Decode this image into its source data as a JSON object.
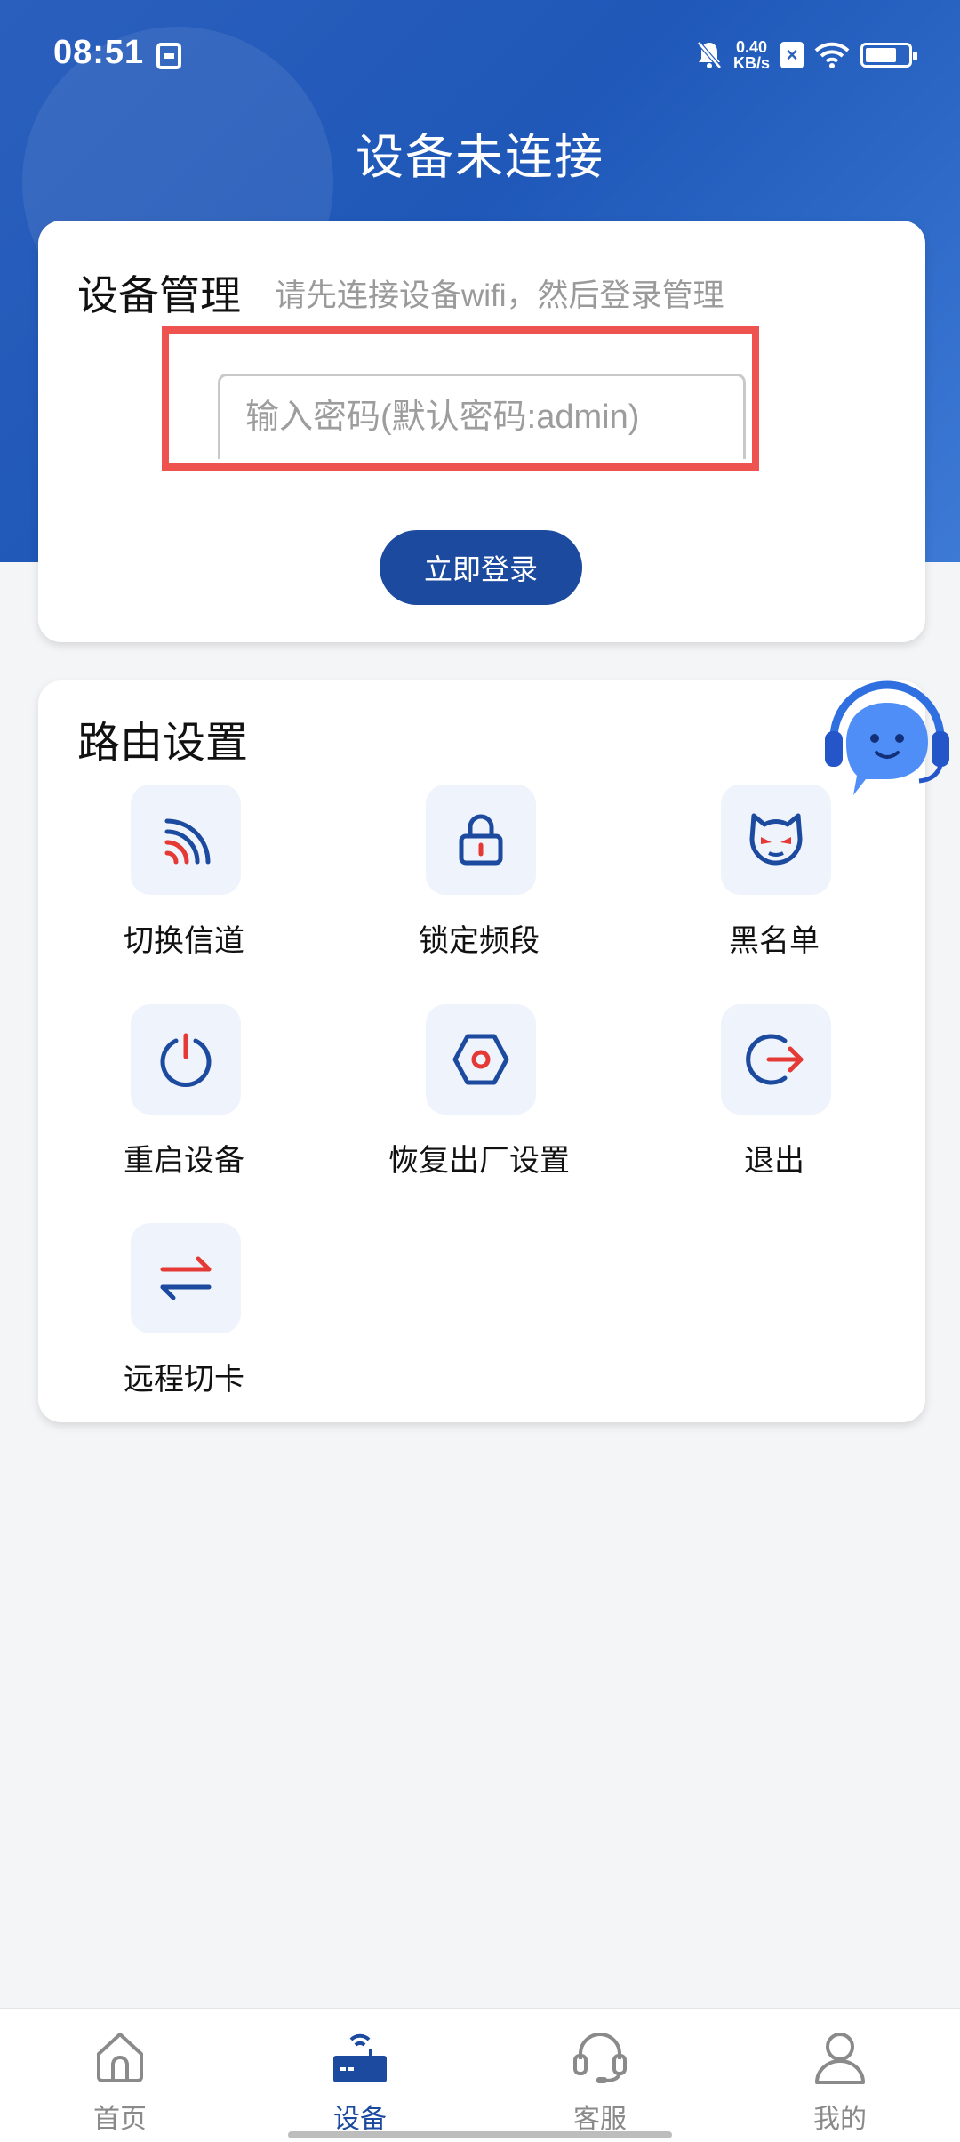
{
  "status_bar": {
    "time": "08:51",
    "net_speed_value": "0.40",
    "net_speed_unit": "KB/s",
    "battery_level": 0.7
  },
  "header": {
    "title": "设备未连接"
  },
  "device_card": {
    "title": "设备管理",
    "hint": "请先连接设备wifi，然后登录管理",
    "password_placeholder": "输入密码(默认密码:admin)",
    "password_value": "",
    "login_label": "立即登录"
  },
  "router_settings": {
    "title": "路由设置",
    "items": [
      {
        "label": "切换信道",
        "icon": "signal-icon"
      },
      {
        "label": "锁定频段",
        "icon": "lock-icon"
      },
      {
        "label": "黑名单",
        "icon": "devil-face-icon"
      },
      {
        "label": "重启设备",
        "icon": "power-icon"
      },
      {
        "label": "恢复出厂设置",
        "icon": "hexagon-reset-icon"
      },
      {
        "label": "退出",
        "icon": "exit-icon"
      },
      {
        "label": "远程切卡",
        "icon": "swap-arrows-icon"
      }
    ]
  },
  "bottom_nav": {
    "items": [
      {
        "label": "首页",
        "icon": "home-icon",
        "active": false
      },
      {
        "label": "设备",
        "icon": "router-icon",
        "active": true
      },
      {
        "label": "客服",
        "icon": "headset-icon",
        "active": false
      },
      {
        "label": "我的",
        "icon": "user-icon",
        "active": false
      }
    ]
  },
  "colors": {
    "primary": "#1c4a9e",
    "header_blue": "#2b5fbd",
    "accent_red": "#e53935",
    "highlight_box": "#ef5350",
    "icon_bg": "#eef3fc"
  }
}
